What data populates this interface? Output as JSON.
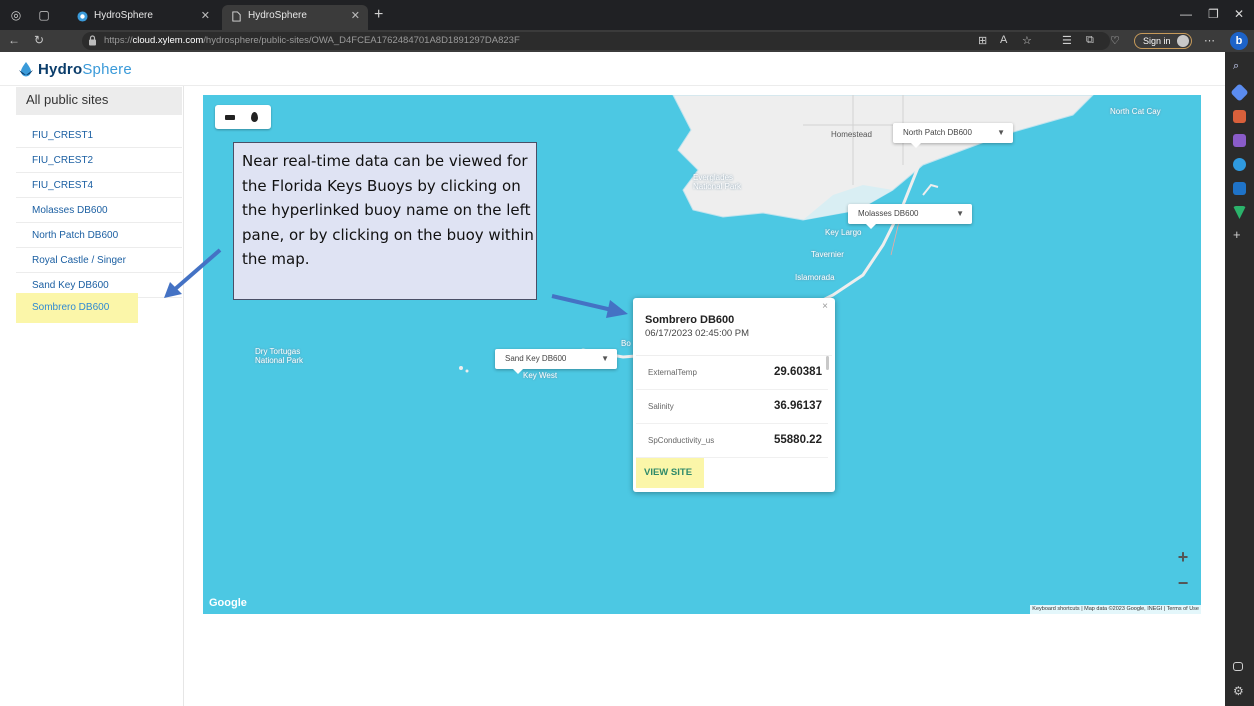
{
  "browser": {
    "tabs": [
      {
        "title": "HydroSphere",
        "active": false,
        "favicon": "hydrosphere-favicon"
      },
      {
        "title": "HydroSphere",
        "active": true,
        "favicon": "page-icon"
      }
    ],
    "new_tab_icon": "+",
    "url_prefix": "https://",
    "url_host": "cloud.xylem.com",
    "url_path": "/hydrosphere/public-sites/OWA_D4FCEA1762484701A8D1891297DA823F",
    "sign_in_label": "Sign in"
  },
  "app": {
    "brand_bold": "Hydro",
    "brand_light": "Sphere"
  },
  "left_pane": {
    "title": "All public sites",
    "sites": [
      "FIU_CREST1",
      "FIU_CREST2",
      "FIU_CREST4",
      "Molasses DB600",
      "North Patch DB600",
      "Royal Castle / Singer",
      "Sand Key DB600",
      "Sombrero DB600"
    ],
    "highlighted_site": "Sombrero DB600"
  },
  "map": {
    "labels": {
      "north_cat_cay": "North Cat Cay",
      "homestead": "Homestead",
      "everglades": "Everglades\nNational Park",
      "key_largo": "Key Largo",
      "tavernier": "Tavernier",
      "islamorada": "Islamorada",
      "dry_tortugas": "Dry Tortugas\nNational Park",
      "key_west": "Key West",
      "marathon_fragment": "Bo"
    },
    "buoy_popups": {
      "north_patch": "North Patch DB600",
      "molasses": "Molasses DB600",
      "sand_key": "Sand Key DB600"
    },
    "zoom_in": "+",
    "zoom_out": "−",
    "google_logo": "Google",
    "attribution": "Keyboard shortcuts | Map data ©2023 Google, INEGI | Terms of Use"
  },
  "info_popup": {
    "site_name": "Sombrero DB600",
    "timestamp": "06/17/2023 02:45:00 PM",
    "rows": [
      {
        "key": "ExternalTemp",
        "value": "29.60381"
      },
      {
        "key": "Salinity",
        "value": "36.96137"
      },
      {
        "key": "SpConductivity_us",
        "value": "55880.22"
      }
    ],
    "view_site_label": "VIEW SITE",
    "close_icon": "×"
  },
  "annotation": {
    "text": "Near real-time data can be viewed for the Florida Keys Buoys by clicking on the hyperlinked buoy name on the left pane, or by clicking on the buoy within the map."
  },
  "colors": {
    "map_water": "#4cc8e3",
    "link": "#1b5fa2",
    "highlight": "#fbf6a9",
    "arrow": "#4472c4"
  }
}
